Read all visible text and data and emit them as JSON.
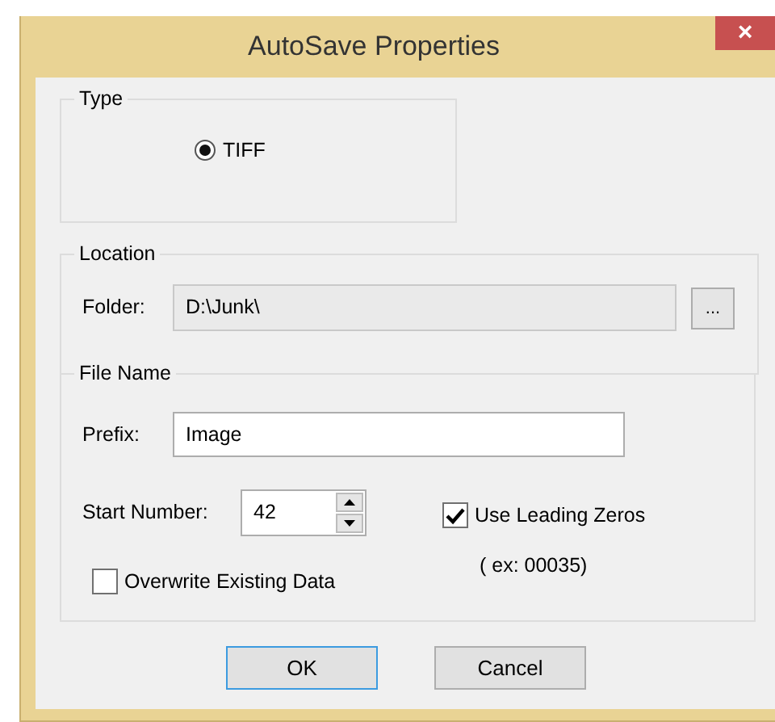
{
  "window": {
    "title": "AutoSave Properties",
    "close_glyph": "×"
  },
  "type_group": {
    "legend": "Type",
    "options": [
      {
        "label": "TIFF",
        "selected": true
      }
    ]
  },
  "location": {
    "legend": "Location",
    "folder_label": "Folder:",
    "folder_value": "D:\\Junk\\",
    "browse_label": "..."
  },
  "file_name": {
    "legend": "File Name",
    "prefix_label": "Prefix:",
    "prefix_value": "Image",
    "start_label": "Start Number:",
    "start_value": "42",
    "leading_zeros": {
      "label": "Use Leading Zeros",
      "checked": true
    },
    "example": "( ex: 00035)",
    "overwrite": {
      "label": "Overwrite Existing Data",
      "checked": false
    }
  },
  "buttons": [
    {
      "label": "OK",
      "default": true
    },
    {
      "label": "Cancel",
      "default": false
    }
  ]
}
